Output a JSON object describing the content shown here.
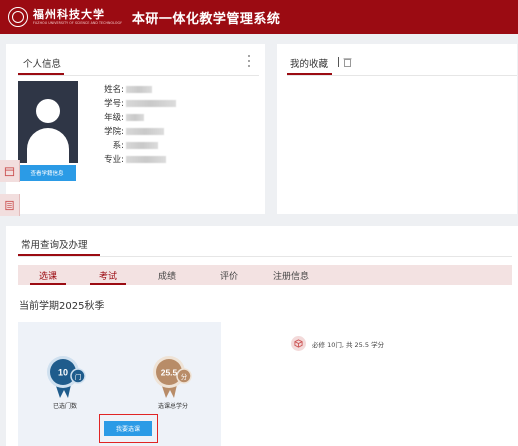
{
  "header": {
    "school_name": "福州科技大学",
    "school_name_en": "FUZHOU UNIVERSITY OF SCIENCE AND TECHNOLOGY",
    "system_title": "本研一体化教学管理系统",
    "background_color": "#9b0b12"
  },
  "personal_info": {
    "title": "个人信息",
    "more_icon": "more-vertical-icon",
    "fields": [
      {
        "label": "姓名:"
      },
      {
        "label": "学号:"
      },
      {
        "label": "年级:"
      },
      {
        "label": "学院:"
      },
      {
        "label": "系:"
      },
      {
        "label": "专业:"
      }
    ],
    "view_button": "查看学籍信息"
  },
  "sidebar": {
    "items": [
      {
        "icon": "calendar-icon"
      },
      {
        "icon": "document-list-icon"
      }
    ]
  },
  "favorites": {
    "title": "我的收藏",
    "separator": "|",
    "icon": "trash-icon"
  },
  "query": {
    "title": "常用查询及办理",
    "tabs": [
      {
        "label": "选课",
        "active": true
      },
      {
        "label": "考试",
        "active": true
      },
      {
        "label": "成绩",
        "active": false
      },
      {
        "label": "评价",
        "active": false
      },
      {
        "label": "注册信息",
        "active": false
      }
    ],
    "term": "当前学期2025秋季",
    "selected_count": {
      "value": "10",
      "unit": "门",
      "label": "已选门数"
    },
    "total_credits": {
      "value": "25.5",
      "unit": "分",
      "label": "选课总学分"
    },
    "select_button": "我要选课",
    "summary": "必修 10门, 共 25.5 学分",
    "summary_icon": "cube-icon",
    "accent_color": "#9b0b12",
    "button_color": "#2b9be6"
  }
}
